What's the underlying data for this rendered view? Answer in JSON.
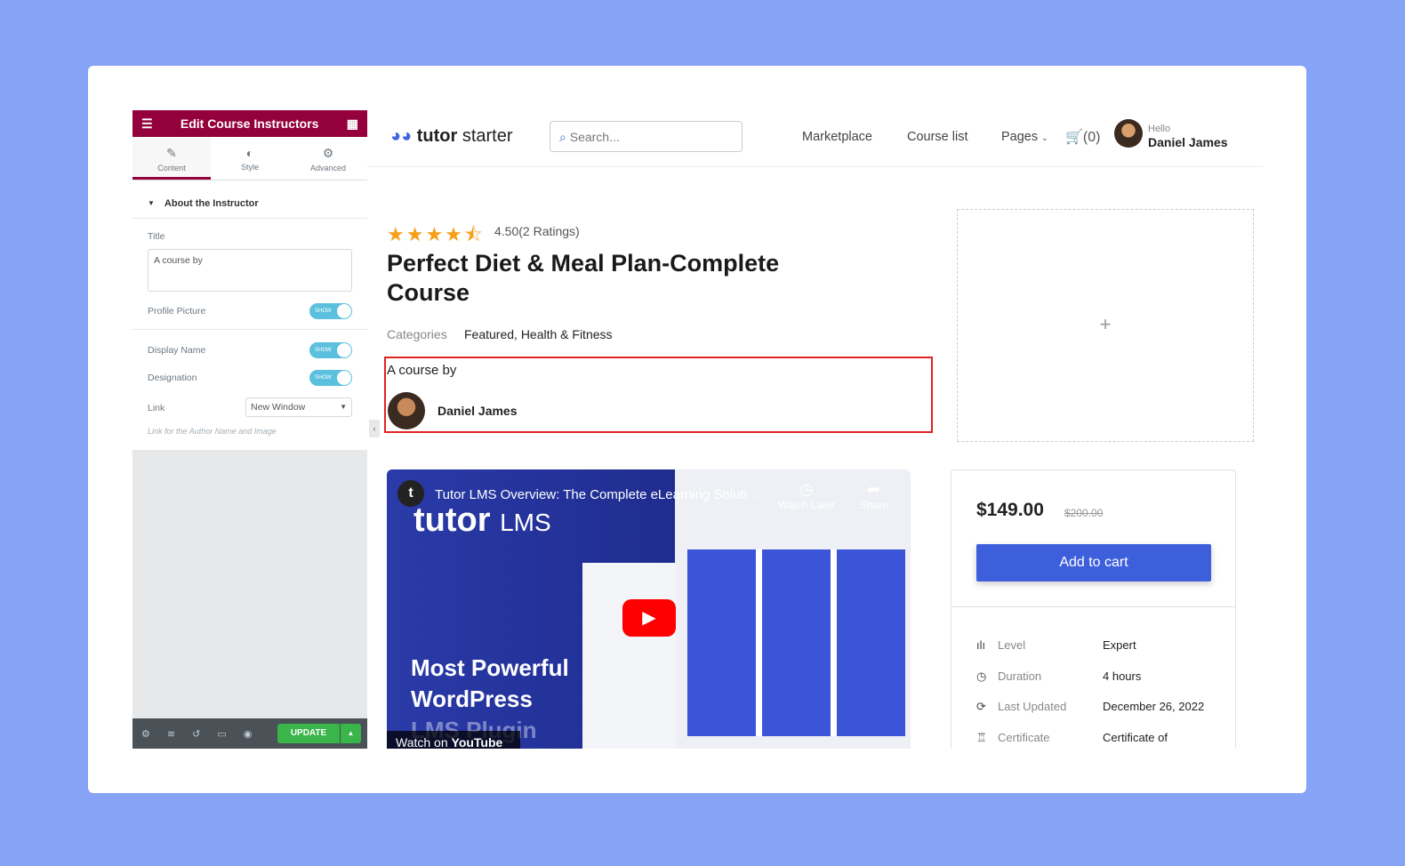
{
  "editor": {
    "title": "Edit Course Instructors",
    "tabs": [
      {
        "label": "Content",
        "icon": "pencil-icon"
      },
      {
        "label": "Style",
        "icon": "half-circle-icon"
      },
      {
        "label": "Advanced",
        "icon": "gear-icon"
      }
    ],
    "section": "About the Instructor",
    "title_label": "Title",
    "title_value": "A course by",
    "profile_picture": "Profile Picture",
    "display_name": "Display Name",
    "designation": "Designation",
    "toggle_text": "SHOW",
    "link_label": "Link",
    "link_value": "New Window",
    "link_hint": "Link for the Author Name and Image",
    "update": "UPDATE"
  },
  "site": {
    "logo": "tutor",
    "logo2": " starter",
    "search_placeholder": "Search...",
    "nav": [
      "Marketplace",
      "Course list",
      "Pages"
    ],
    "cart": "(0)",
    "hello": "Hello",
    "user": "Daniel James"
  },
  "course": {
    "rating": 4.5,
    "rating_text": "4.50(2 Ratings)",
    "title": "Perfect Diet & Meal Plan-Complete Course",
    "categories_label": "Categories",
    "categories": "Featured, Health & Fitness",
    "instructor_title": "A course by",
    "instructor_name": "Daniel James"
  },
  "video": {
    "title": "Tutor LMS Overview: The Complete eLearning Soluti...",
    "watch_later": "Watch Later",
    "share": "Share",
    "brand": "tutor",
    "brand2": "LMS",
    "headline1": "Most Powerful",
    "headline2": "WordPress",
    "headline3": "LMS Plugin",
    "watch_on": "Watch on",
    "youtube": "YouTube"
  },
  "pricing": {
    "price": "$149.00",
    "old_price": "$200.00",
    "button": "Add to cart",
    "meta": [
      {
        "icon": "level-bars-icon",
        "label": "Level",
        "value": "Expert"
      },
      {
        "icon": "clock-icon",
        "label": "Duration",
        "value": "4 hours"
      },
      {
        "icon": "refresh-icon",
        "label": "Last Updated",
        "value": "December 26, 2022"
      },
      {
        "icon": "certificate-icon",
        "label": "Certificate",
        "value": "Certificate of completion"
      }
    ]
  },
  "colors": {
    "editor_brand": "#93003c",
    "accent": "#3e64de",
    "update": "#39b54a",
    "highlight": "#e02424"
  }
}
